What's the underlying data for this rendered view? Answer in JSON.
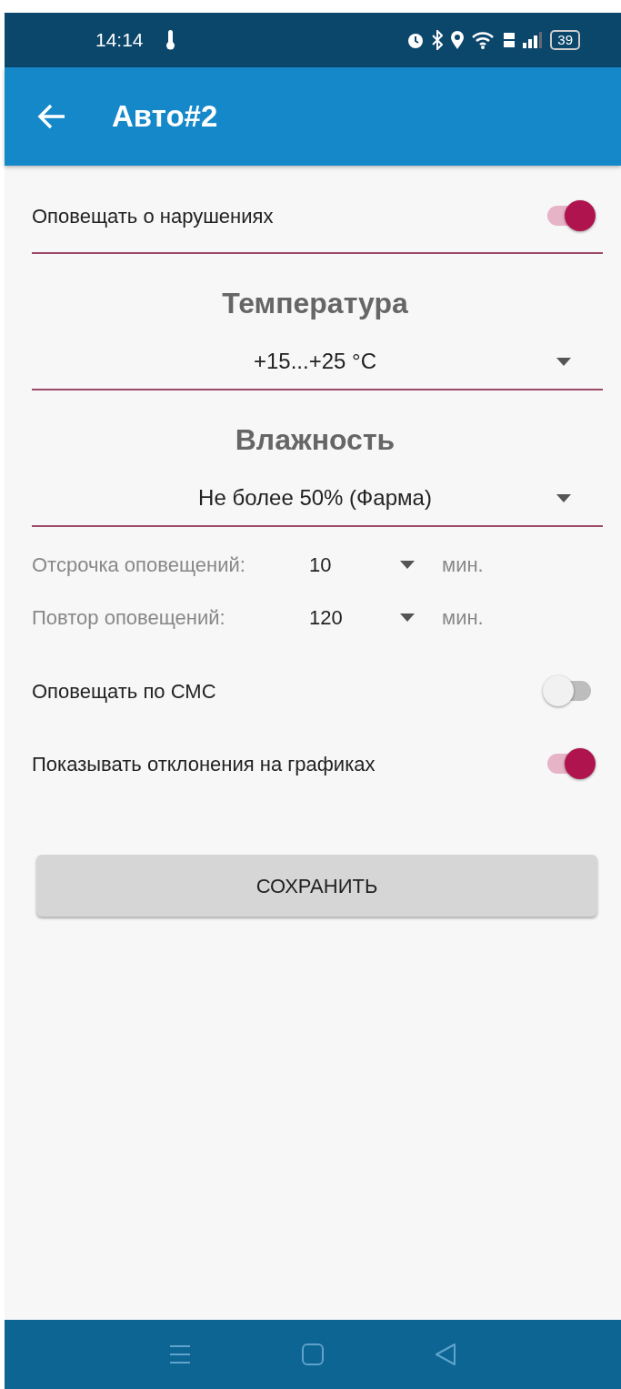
{
  "status_bar": {
    "time": "14:14",
    "battery": "39"
  },
  "app_bar": {
    "title": "Авто#2"
  },
  "alert_toggle": {
    "label": "Оповещать о нарушениях",
    "on": true
  },
  "sections": [
    {
      "title": "Температура",
      "value": "+15...+25 °C"
    },
    {
      "title": "Влажность",
      "value": "Не более 50% (Фарма)"
    }
  ],
  "timers": [
    {
      "label": "Отсрочка оповещений:",
      "value": "10",
      "unit": "мин."
    },
    {
      "label": "Повтор оповещений:",
      "value": "120",
      "unit": "мин."
    }
  ],
  "toggles": [
    {
      "label": "Оповещать по СМС",
      "on": false
    },
    {
      "label": "Показывать отклонения на графиках",
      "on": true
    }
  ],
  "save_button": "СОХРАНИТЬ"
}
